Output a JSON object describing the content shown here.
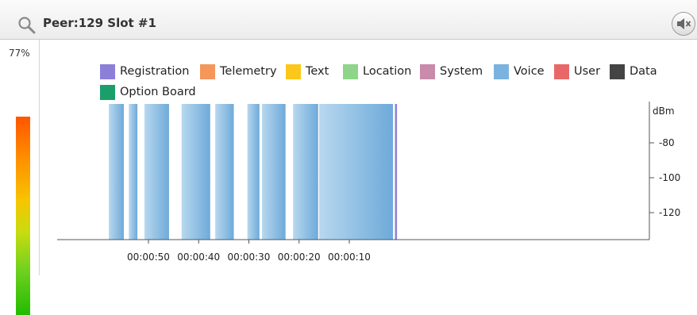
{
  "window": {
    "title": "Peer:129 Slot #1"
  },
  "meter": {
    "percent_label": "77%"
  },
  "legend": [
    {
      "label": "Registration",
      "color": "#8b7fd8"
    },
    {
      "label": "Telemetry",
      "color": "#f5975a"
    },
    {
      "label": "Text",
      "color": "#fbc81a"
    },
    {
      "label": "Location",
      "color": "#8ed58a"
    },
    {
      "label": "System",
      "color": "#c98aab"
    },
    {
      "label": "Voice",
      "color": "#7cb3de"
    },
    {
      "label": "User",
      "color": "#e8686a"
    },
    {
      "label": "Data",
      "color": "#444444"
    },
    {
      "label": "Option Board",
      "color": "#1a9e6a"
    }
  ],
  "chart_data": {
    "type": "bar",
    "x_axis": {
      "ticks": [
        "00:00:50",
        "00:00:40",
        "00:00:30",
        "00:00:20",
        "00:00:10"
      ]
    },
    "y_axis": {
      "unit": "dBm",
      "ticks": [
        "-80",
        "-100",
        "-120"
      ]
    },
    "series": [
      {
        "name": "Voice",
        "segments": [
          {
            "start_s": 57.9,
            "end_s": 54.9
          },
          {
            "start_s": 53.9,
            "end_s": 52.2
          },
          {
            "start_s": 50.8,
            "end_s": 45.9
          },
          {
            "start_s": 43.4,
            "end_s": 37.7
          },
          {
            "start_s": 36.7,
            "end_s": 33.0
          },
          {
            "start_s": 30.3,
            "end_s": 27.9
          },
          {
            "start_s": 27.4,
            "end_s": 22.7
          },
          {
            "start_s": 21.2,
            "end_s": 16.2
          },
          {
            "start_s": 16.0,
            "end_s": 1.3
          }
        ]
      },
      {
        "name": "Registration",
        "segments": [
          {
            "start_s": 0.9,
            "end_s": 0.5
          }
        ]
      }
    ]
  }
}
